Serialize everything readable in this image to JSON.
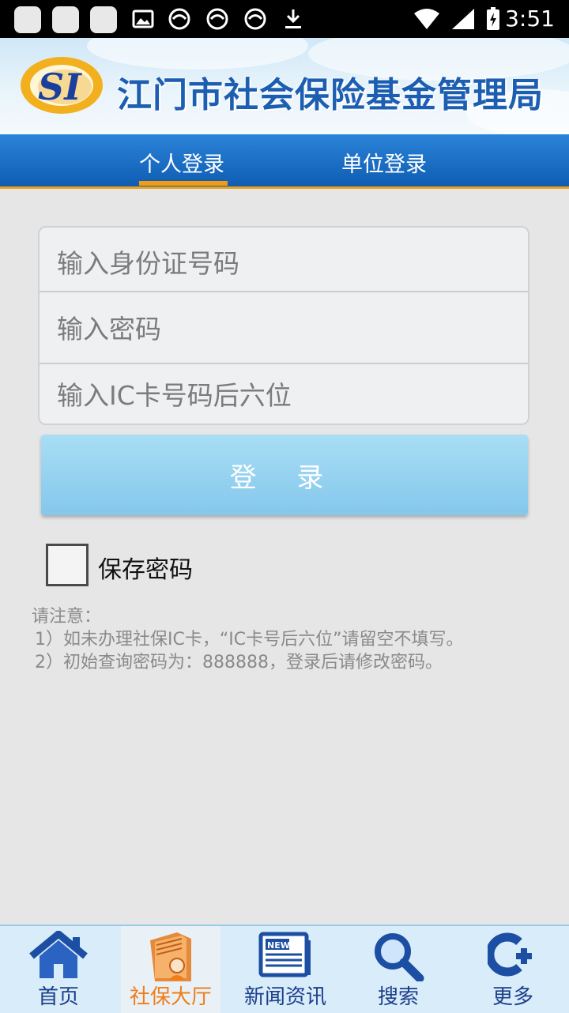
{
  "status_bar": {
    "time": "3:51"
  },
  "header": {
    "title": "江门市社会保险基金管理局",
    "logo_text": "SI"
  },
  "tabs": [
    {
      "label": "个人登录",
      "active": true
    },
    {
      "label": "单位登录",
      "active": false
    }
  ],
  "form": {
    "id_placeholder": "输入身份证号码",
    "password_placeholder": "输入密码",
    "ic_placeholder": "输入IC卡号码后六位",
    "login_label": "登 录",
    "save_password_label": "保存密码",
    "save_password_checked": false
  },
  "notes": {
    "title": "请注意：",
    "line1": "1）如未办理社保IC卡，“IC卡号后六位”请留空不填写。",
    "line2": "2）初始查询密码为：888888，登录后请修改密码。"
  },
  "bottom_nav": [
    {
      "label": "首页",
      "icon": "home-icon",
      "active": false
    },
    {
      "label": "社保大厅",
      "icon": "social-security-hall-icon",
      "active": true
    },
    {
      "label": "新闻资讯",
      "icon": "news-icon",
      "active": false
    },
    {
      "label": "搜索",
      "icon": "search-icon",
      "active": false
    },
    {
      "label": "更多",
      "icon": "more-icon",
      "active": false
    }
  ],
  "colors": {
    "tab_bg": "#0f5db3",
    "accent": "#f39c12",
    "button": "#a9def4",
    "nav_text": "#1c3f8a",
    "nav_active": "#ef7d18"
  }
}
